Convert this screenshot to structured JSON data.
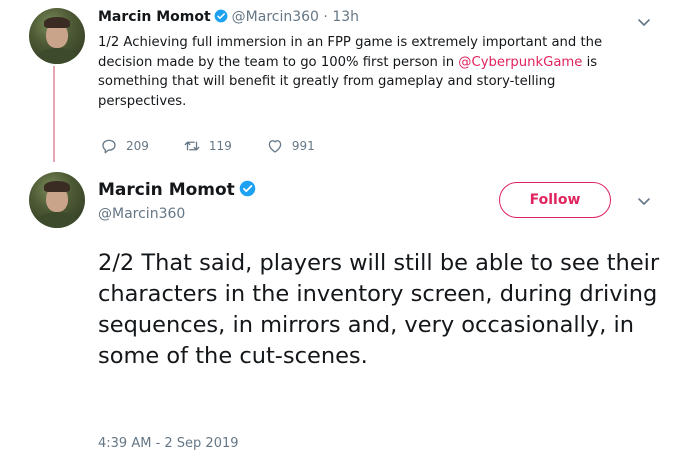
{
  "tweet1": {
    "name": "Marcin Momot",
    "handle": "@Marcin360",
    "time_sep": " · ",
    "time": "13h",
    "text_before": "1/2 Achieving full immersion in an FPP game is extremely important and the decision made by the team to go 100% first person in ",
    "mention": "@CyberpunkGame",
    "text_after": " is something that will benefit it greatly from gameplay and story-telling perspectives.",
    "reply_count": "209",
    "retweet_count": "119",
    "like_count": "991"
  },
  "tweet2": {
    "name": "Marcin Momot",
    "handle": "@Marcin360",
    "follow_label": "Follow",
    "text": "2/2 That said, players will still be able to see their characters in the inventory screen, during driving sequences, in mirrors and, very occasionally, in some of the cut-scenes.",
    "timestamp": "4:39 AM - 2 Sep 2019"
  },
  "colors": {
    "accent": "#e0245e",
    "verified": "#1da1f2",
    "muted": "#657786",
    "thread_line": "#e6a6b6"
  },
  "icons": {
    "reply": "reply-icon",
    "retweet": "retweet-icon",
    "like": "heart-icon",
    "verified": "verified-badge-icon",
    "more": "chevron-down-icon"
  }
}
